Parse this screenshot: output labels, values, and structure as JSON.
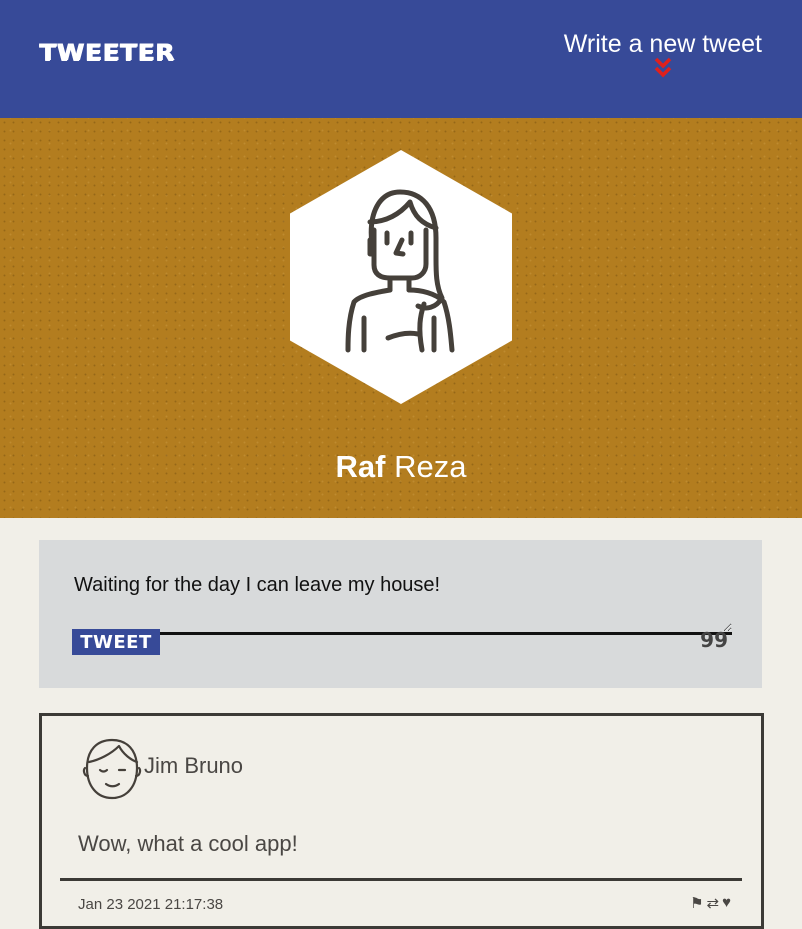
{
  "nav": {
    "brand": "TWEETER",
    "write_first": "Write",
    "write_rest": "a new tweet",
    "chevron_icon": "double-chevron-down-icon"
  },
  "profile": {
    "first_name": "Raf",
    "last_name": "Reza",
    "avatar_icon": "woman-avatar-icon",
    "background_color": "#b37d1f"
  },
  "composer": {
    "value": "Waiting for the day I can leave my house!",
    "button_label": "TWEET",
    "counter": "99"
  },
  "tweets": [
    {
      "author": "Jim Bruno",
      "avatar_icon": "man-avatar-icon",
      "text": "Wow, what a cool app!",
      "date": "Jan 23 2021 21:17:38",
      "actions": [
        "flag-icon",
        "retweet-icon",
        "heart-icon"
      ]
    }
  ],
  "colors": {
    "nav": "#374a98",
    "accent": "#e0201c",
    "page": "#f1efe8"
  }
}
